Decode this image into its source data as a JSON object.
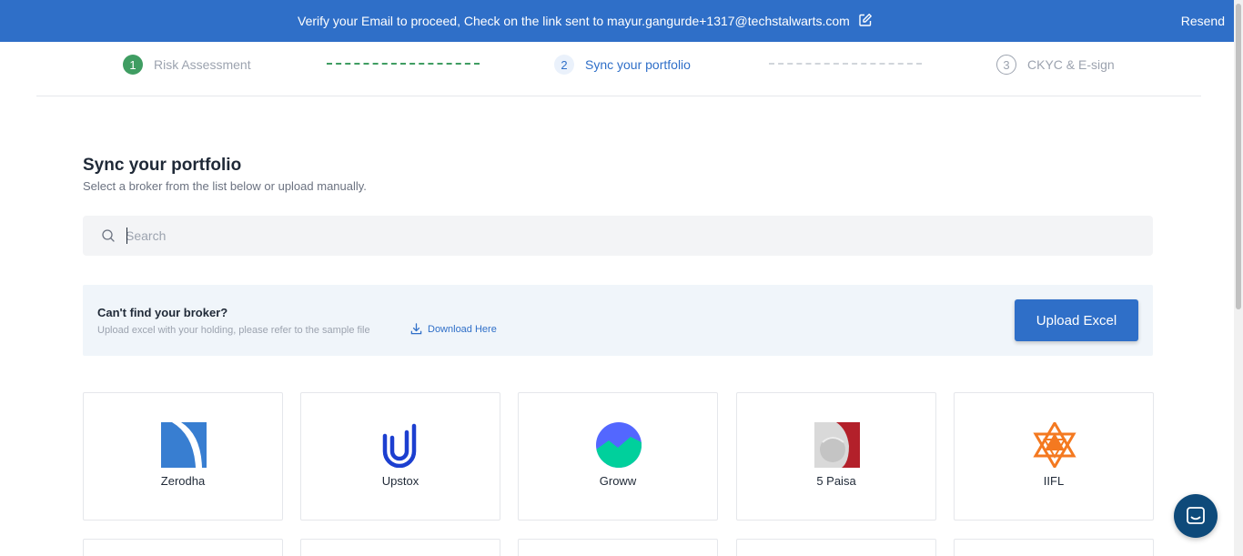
{
  "banner": {
    "message": "Verify your Email to proceed, Check on the link sent to mayur.gangurde+1317@techstalwarts.com",
    "resend_label": "Resend",
    "edit_icon": "edit-icon"
  },
  "stepper": {
    "steps": [
      {
        "number": "1",
        "label": "Risk Assessment",
        "state": "completed"
      },
      {
        "number": "2",
        "label": "Sync your portfolio",
        "state": "active"
      },
      {
        "number": "3",
        "label": "CKYC & E-sign",
        "state": "pending"
      }
    ]
  },
  "main": {
    "title": "Sync your portfolio",
    "subtitle": "Select a broker from the list below or upload manually."
  },
  "search": {
    "placeholder": "Search",
    "value": "",
    "icon": "search-icon"
  },
  "upload": {
    "title": "Can't find your broker?",
    "description": "Upload excel with your holding,  please refer to the sample file",
    "download_label": "Download Here",
    "button_label": "Upload Excel"
  },
  "brokers": [
    {
      "name": "Zerodha",
      "icon": "zerodha-logo"
    },
    {
      "name": "Upstox",
      "icon": "upstox-logo"
    },
    {
      "name": "Groww",
      "icon": "groww-logo"
    },
    {
      "name": "5 Paisa",
      "icon": "5paisa-logo"
    },
    {
      "name": "IIFL",
      "icon": "iifl-logo"
    }
  ],
  "colors": {
    "primary": "#2f6fc8",
    "success": "#3f9d62",
    "chat": "#0e4a7a"
  }
}
